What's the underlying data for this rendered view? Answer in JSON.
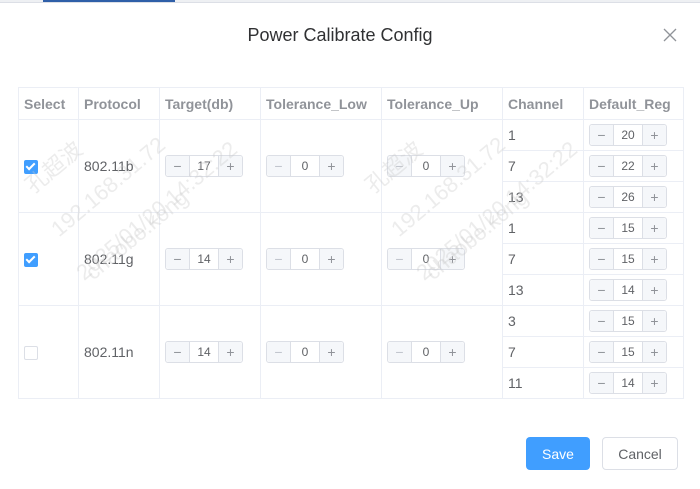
{
  "dialog": {
    "title": "Power Calibrate Config"
  },
  "columns": [
    "Select",
    "Protocol",
    "Target(db)",
    "Tolerance_Low",
    "Tolerance_Up",
    "Channel",
    "Default_Reg"
  ],
  "rows": [
    {
      "checked": true,
      "protocol": "802.11b",
      "target": "17",
      "tol_low": "0",
      "tol_up": "0",
      "channels": [
        {
          "ch": "1",
          "reg": "20"
        },
        {
          "ch": "7",
          "reg": "22"
        },
        {
          "ch": "13",
          "reg": "26"
        }
      ]
    },
    {
      "checked": true,
      "protocol": "802.11g",
      "target": "14",
      "tol_low": "0",
      "tol_up": "0",
      "channels": [
        {
          "ch": "1",
          "reg": "15"
        },
        {
          "ch": "7",
          "reg": "15"
        },
        {
          "ch": "13",
          "reg": "14"
        }
      ]
    },
    {
      "checked": false,
      "protocol": "802.11n",
      "target": "14",
      "tol_low": "0",
      "tol_up": "0",
      "channels": [
        {
          "ch": "3",
          "reg": "15"
        },
        {
          "ch": "7",
          "reg": "15"
        },
        {
          "ch": "11",
          "reg": "14"
        }
      ]
    }
  ],
  "stepper": {
    "minus": "−",
    "plus": "+"
  },
  "watermark": {
    "line1": "孔超波",
    "line2": "192.168.31.72",
    "line3": "2025/01/20 14:32:22",
    "line4": "chaobo.kong"
  },
  "footer": {
    "save_label": "Save",
    "cancel_label": "Cancel"
  },
  "colors": {
    "primary": "#409eff",
    "border": "#ebeef5",
    "header_text": "#909399"
  }
}
